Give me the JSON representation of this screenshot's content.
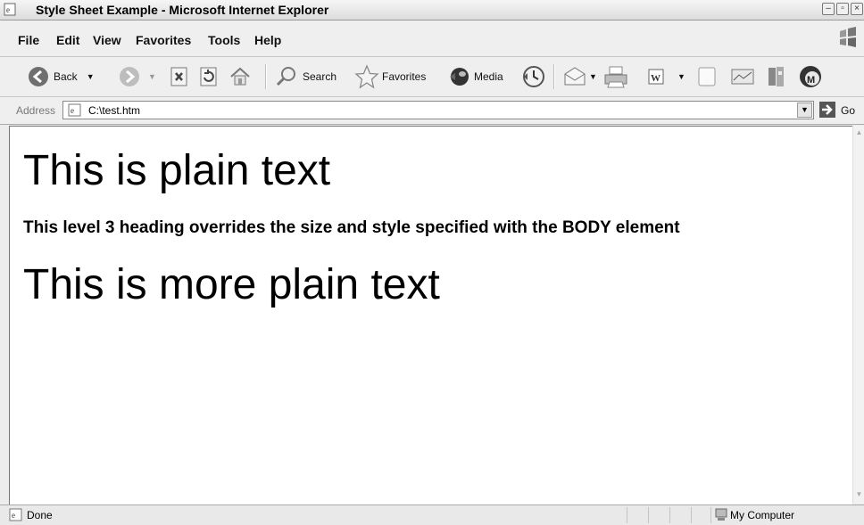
{
  "window": {
    "title": "Style Sheet Example - Microsoft Internet Explorer"
  },
  "menu": [
    "File",
    "Edit",
    "View",
    "Favorites",
    "Tools",
    "Help"
  ],
  "toolbar": {
    "back_label": "Back",
    "search_label": "Search",
    "favorites_label": "Favorites",
    "media_label": "Media"
  },
  "address": {
    "label": "Address",
    "url": "C:\\test.htm",
    "go_label": "Go"
  },
  "page": {
    "line1": "This is plain text",
    "heading": "This level 3 heading overrides the size and style specified with the BODY element",
    "line2": "This is more plain text"
  },
  "status": {
    "text": "Done",
    "zone": "My Computer"
  },
  "icons": [
    "ie-page-icon",
    "back-arrow-icon",
    "forward-arrow-icon",
    "stop-icon",
    "refresh-icon",
    "home-icon",
    "search-icon",
    "favorites-star-icon",
    "media-icon",
    "history-icon",
    "mail-icon",
    "print-icon",
    "edit-word-icon",
    "discuss-icon",
    "messenger-icon",
    "research-icon",
    "go-arrow-icon",
    "my-computer-icon",
    "windows-logo-icon"
  ]
}
